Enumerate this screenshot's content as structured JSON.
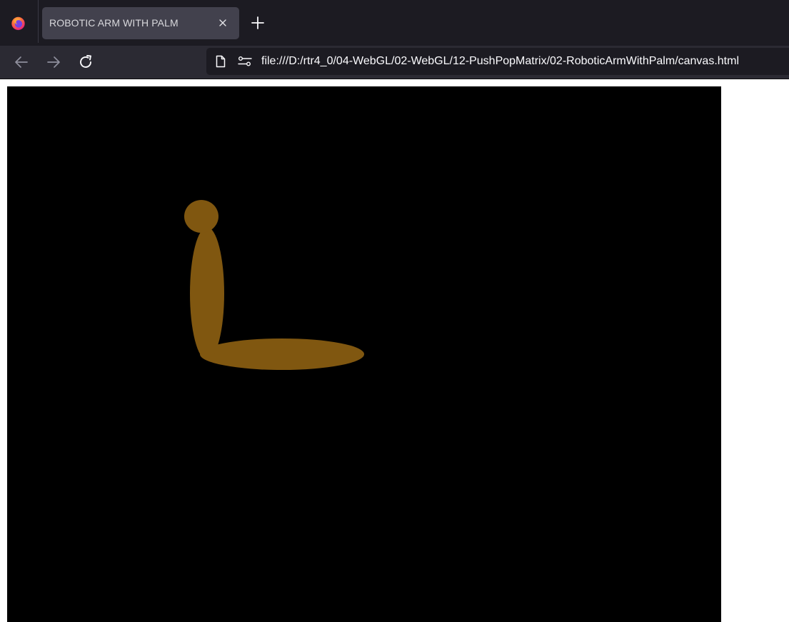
{
  "browser": {
    "tab": {
      "title": "ROBOTIC ARM WITH PALM",
      "close_icon": "close-icon"
    },
    "new_tab_icon": "plus-icon",
    "nav": {
      "back_icon": "arrow-left-icon",
      "forward_icon": "arrow-right-icon",
      "reload_icon": "reload-icon"
    },
    "url_bar": {
      "url": "file:///D:/rtr4_0/04-WebGL/02-WebGL/12-PushPopMatrix/02-RoboticArmWithPalm/canvas.html",
      "page_icon": "document-icon",
      "permissions_icon": "permissions-icon"
    }
  },
  "scene": {
    "background_color": "#000000",
    "arm_color": "#805710"
  },
  "colors": {
    "tab_strip": "#1c1b22",
    "toolbar": "#2b2a33",
    "active_tab": "#42414d",
    "url_field": "#1c1b22"
  }
}
